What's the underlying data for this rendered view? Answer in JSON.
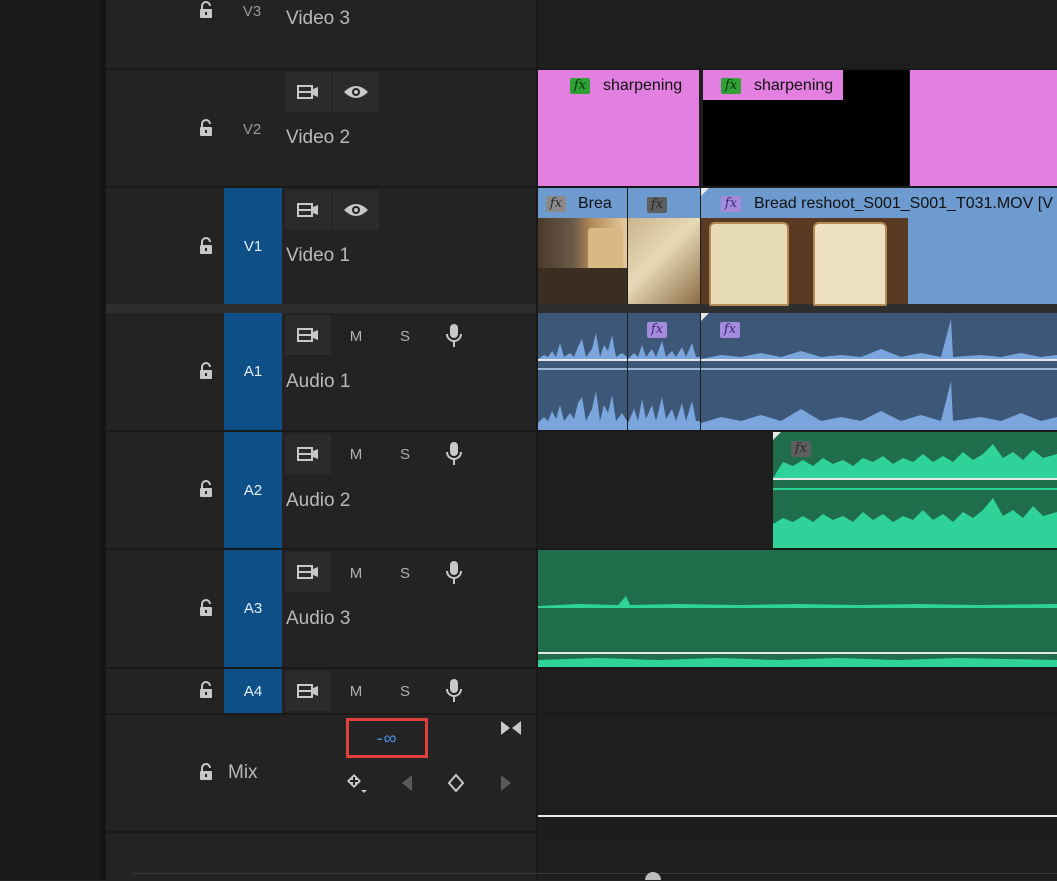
{
  "tracks": {
    "v3": {
      "tag": "V3",
      "name": "Video 3"
    },
    "v2": {
      "tag": "V2",
      "name": "Video 2"
    },
    "v1": {
      "tag": "V1",
      "name": "Video 1"
    },
    "a1": {
      "tag": "A1",
      "name": "Audio 1"
    },
    "a2": {
      "tag": "A2",
      "name": "Audio 2"
    },
    "a3": {
      "tag": "A3",
      "name": "Audio 3"
    },
    "a4": {
      "tag": "A4",
      "name": ""
    },
    "mix": {
      "tag": "Mix",
      "value": "-∞"
    }
  },
  "audio_buttons": {
    "mute": "M",
    "solo": "S"
  },
  "clips": {
    "v2_clip1": {
      "fx": "fx",
      "label": "sharpening"
    },
    "v2_clip2": {
      "fx": "fx",
      "label": "sharpening"
    },
    "v1_clip1": {
      "fx": "fx",
      "label": "Brea"
    },
    "v1_clip2": {
      "fx": "fx"
    },
    "v1_clip3": {
      "fx": "fx",
      "label": "Bread reshoot_S001_S001_T031.MOV [V"
    },
    "a1_clip2": {
      "fx": "fx"
    },
    "a1_clip3": {
      "fx": "fx"
    },
    "a2_clip1": {
      "fx": "fx"
    }
  },
  "colors": {
    "track_selected": "#0d4f86",
    "adjustment_clip": "#e37fe0",
    "video_clip": "#6d9bd0",
    "audio_clip": "#3c5778",
    "audio_wave": "#7aa6dd",
    "audio_clip_green": "#1f6d4b",
    "audio_wave_green": "#2fd39a",
    "highlight": "#e2403c",
    "mix_value": "#4a8fe3"
  },
  "icons": [
    "lock-icon",
    "sync-lock-icon",
    "eye-icon",
    "microphone-icon",
    "keyframe-add-icon",
    "prev-keyframe-icon",
    "keyframe-icon",
    "next-keyframe-icon",
    "collapse-icon"
  ]
}
